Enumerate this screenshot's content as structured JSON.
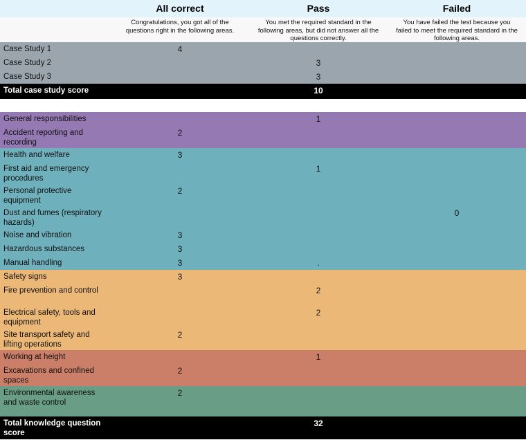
{
  "header": {
    "row_label_col": "",
    "columns": [
      {
        "title": "All correct",
        "description": "Congratulations, you got all of the questions right in the following areas."
      },
      {
        "title": "Pass",
        "description": "You met the required standard in the following areas, but did not answer all the questions correctly."
      },
      {
        "title": "Failed",
        "description": "You have failed the test because you failed to meet the required standard in the following areas."
      }
    ]
  },
  "colors": {
    "header_title_band": "#e2f3fb",
    "header_desc_band": "#f8f8f8",
    "gray": "#9aa5ae",
    "purple": "#9479b3",
    "teal": "#6fb0bd",
    "orange": "#ecb877",
    "red": "#cc7f68",
    "green": "#6a9d85",
    "total_row": "#000000"
  },
  "chart_data": {
    "type": "table",
    "title": "",
    "columns": [
      "",
      "All correct",
      "Pass",
      "Failed"
    ],
    "sections": [
      {
        "name": "case-studies",
        "color": "#9aa5ae",
        "rows": [
          {
            "label": "Case Study 1",
            "all_correct": "4",
            "pass": "",
            "failed": "",
            "lines": 1
          },
          {
            "label": "Case Study 2",
            "all_correct": "",
            "pass": "3",
            "failed": "",
            "lines": 1
          },
          {
            "label": "Case Study 3",
            "all_correct": "",
            "pass": "3",
            "failed": "",
            "lines": 1
          }
        ],
        "total": {
          "label": "Total case study score",
          "all_correct": "",
          "pass": "10",
          "failed": "",
          "lines": 1
        }
      },
      {
        "name": "general",
        "color": "#9479b3",
        "rows": [
          {
            "label": "General responsibilities",
            "all_correct": "",
            "pass": "1",
            "failed": "",
            "lines": 1
          },
          {
            "label": "Accident reporting and recording",
            "all_correct": "2",
            "pass": "",
            "failed": "",
            "lines": 2
          }
        ]
      },
      {
        "name": "health-and-welfare",
        "color": "#6fb0bd",
        "rows": [
          {
            "label": "Health and welfare",
            "all_correct": "3",
            "pass": "",
            "failed": "",
            "lines": 1
          },
          {
            "label": "First aid and emergency procedures",
            "all_correct": "",
            "pass": "1",
            "failed": "",
            "lines": 2
          },
          {
            "label": "Personal protective equipment",
            "all_correct": "2",
            "pass": "",
            "failed": "",
            "lines": 2
          },
          {
            "label": "Dust and fumes (respiratory hazards)",
            "all_correct": "",
            "pass": "",
            "failed": "0",
            "lines": 2
          },
          {
            "label": "Noise and vibration",
            "all_correct": "3",
            "pass": "",
            "failed": "",
            "lines": 1
          },
          {
            "label": "Hazardous substances",
            "all_correct": "3",
            "pass": "",
            "failed": "",
            "lines": 1
          },
          {
            "label": "Manual handling",
            "all_correct": "3",
            "pass": ".",
            "failed": "",
            "lines": 1
          }
        ]
      },
      {
        "name": "general-safety",
        "color": "#ecb877",
        "rows": [
          {
            "label": "Safety signs",
            "all_correct": "3",
            "pass": "",
            "failed": "",
            "lines": 1
          },
          {
            "label": "Fire prevention and control",
            "all_correct": "",
            "pass": "2",
            "failed": "",
            "lines": 2
          },
          {
            "label": "Electrical safety, tools and equipment",
            "all_correct": "",
            "pass": "2",
            "failed": "",
            "lines": 2
          },
          {
            "label": "Site transport safety and lifting operations",
            "all_correct": "2",
            "pass": "",
            "failed": "",
            "lines": 2
          }
        ]
      },
      {
        "name": "high-risk-activities",
        "color": "#cc7f68",
        "rows": [
          {
            "label": "Working at height",
            "all_correct": "",
            "pass": "1",
            "failed": "",
            "lines": 1
          },
          {
            "label": "Excavations and confined spaces",
            "all_correct": "2",
            "pass": "",
            "failed": "",
            "lines": 2
          }
        ]
      },
      {
        "name": "environment",
        "color": "#6a9d85",
        "rows": [
          {
            "label": "Environmental awareness and waste control",
            "all_correct": "2",
            "pass": "",
            "failed": "",
            "lines": 3
          }
        ],
        "total": {
          "label": "Total knowledge question score",
          "all_correct": "",
          "pass": "32",
          "failed": "",
          "lines": 2
        }
      }
    ]
  }
}
